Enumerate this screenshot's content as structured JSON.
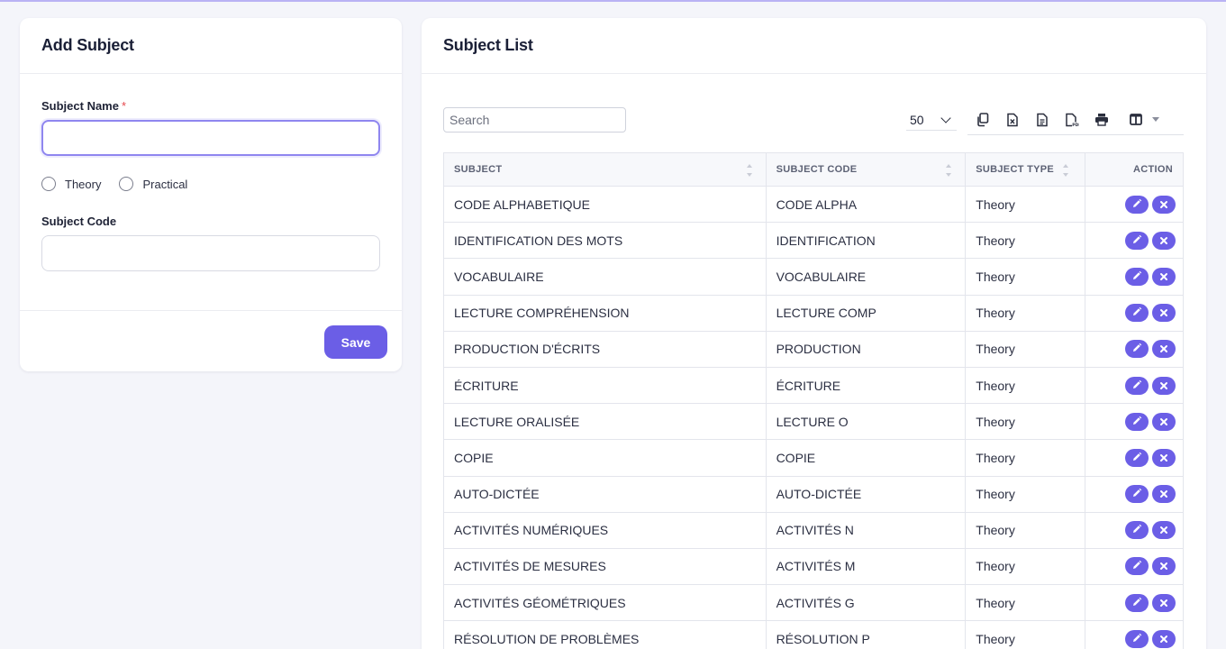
{
  "add_subject": {
    "title": "Add Subject",
    "subject_name_label": "Subject Name",
    "required_marker": "*",
    "subject_name_value": "",
    "radio_theory": "Theory",
    "radio_practical": "Practical",
    "subject_code_label": "Subject Code",
    "subject_code_value": "",
    "save_label": "Save"
  },
  "subject_list": {
    "title": "Subject List",
    "search_placeholder": "Search",
    "per_page": "50",
    "toolbar_icons": [
      "copy-icon",
      "excel-icon",
      "csv-icon",
      "pdf-icon",
      "print-icon",
      "columns-icon"
    ],
    "columns": [
      "SUBJECT",
      "SUBJECT CODE",
      "SUBJECT TYPE",
      "ACTION"
    ],
    "rows": [
      {
        "subject": "CODE ALPHABETIQUE",
        "code": "CODE ALPHA",
        "type": "Theory"
      },
      {
        "subject": "IDENTIFICATION DES MOTS",
        "code": "IDENTIFICATION",
        "type": "Theory"
      },
      {
        "subject": "VOCABULAIRE",
        "code": "VOCABULAIRE",
        "type": "Theory"
      },
      {
        "subject": "LECTURE COMPRÉHENSION",
        "code": "LECTURE COMP",
        "type": "Theory"
      },
      {
        "subject": "PRODUCTION D'ÉCRITS",
        "code": "PRODUCTION",
        "type": "Theory"
      },
      {
        "subject": "ÉCRITURE",
        "code": "ÉCRITURE",
        "type": "Theory"
      },
      {
        "subject": "LECTURE ORALISÉE",
        "code": "LECTURE O",
        "type": "Theory"
      },
      {
        "subject": "COPIE",
        "code": "COPIE",
        "type": "Theory"
      },
      {
        "subject": "AUTO-DICTÉE",
        "code": "AUTO-DICTÉE",
        "type": "Theory"
      },
      {
        "subject": "ACTIVITÉS NUMÉRIQUES",
        "code": "ACTIVITÉS N",
        "type": "Theory"
      },
      {
        "subject": "ACTIVITÉS DE MESURES",
        "code": "ACTIVITÉS M",
        "type": "Theory"
      },
      {
        "subject": "ACTIVITÉS GÉOMÉTRIQUES",
        "code": "ACTIVITÉS G",
        "type": "Theory"
      },
      {
        "subject": "RÉSOLUTION DE PROBLÈMES",
        "code": "RÉSOLUTION P",
        "type": "Theory"
      }
    ]
  },
  "colors": {
    "accent": "#6b5ee6",
    "focus_border": "#8f86ef",
    "background": "#f4f5fa"
  }
}
